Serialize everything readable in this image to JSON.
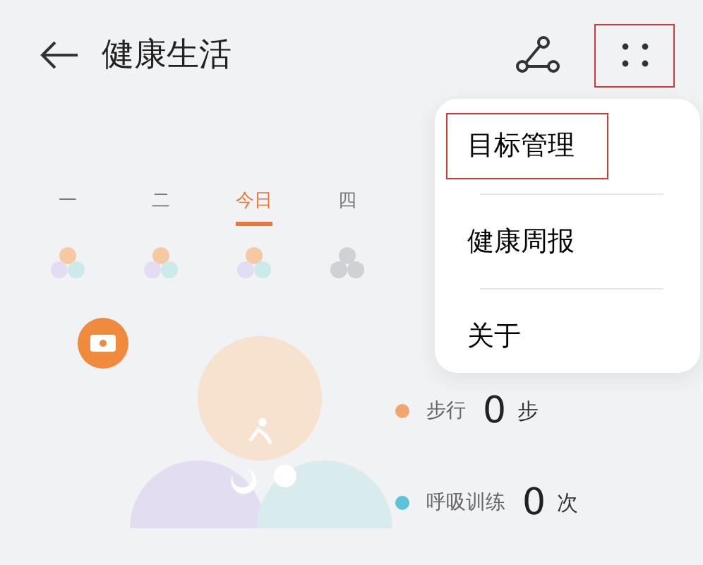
{
  "header": {
    "title": "健康生活",
    "more_highlighted": true
  },
  "days": [
    {
      "label": "一",
      "selected": false,
      "has_data": true
    },
    {
      "label": "二",
      "selected": false,
      "has_data": true
    },
    {
      "label": "今日",
      "selected": true,
      "has_data": true
    },
    {
      "label": "四",
      "selected": false,
      "has_data": false
    }
  ],
  "stats": [
    {
      "label": "步行",
      "value": "0",
      "unit": "步",
      "color": "#f3a56b"
    },
    {
      "label": "呼吸训练",
      "value": "0",
      "unit": "次",
      "color": "#5cc3d8"
    }
  ],
  "menu": {
    "items": [
      {
        "label": "目标管理",
        "highlighted": true
      },
      {
        "label": "健康周报",
        "highlighted": false
      },
      {
        "label": "关于",
        "highlighted": false
      }
    ]
  }
}
